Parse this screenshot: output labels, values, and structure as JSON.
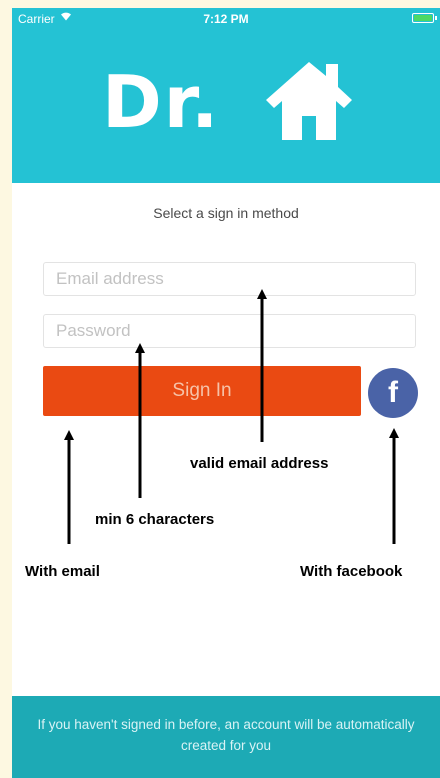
{
  "status_bar": {
    "carrier": "Carrier",
    "time": "7:12 PM"
  },
  "header": {
    "logo_text": "Dr."
  },
  "subtitle": "Select a sign in method",
  "email": {
    "placeholder": "Email address"
  },
  "password": {
    "placeholder": "Password"
  },
  "sign_in_label": "Sign In",
  "facebook_label": "f",
  "annotations": {
    "valid_email": "valid email address",
    "min_chars": "min 6 characters",
    "with_email": "With email",
    "with_facebook": "With facebook"
  },
  "footer_text": "If you haven't signed in before, an account will be automatically created for you",
  "colors": {
    "header": "#24c2d4",
    "sign_in": "#ea4a12",
    "facebook": "#4a63a7",
    "footer": "#1daab5"
  }
}
